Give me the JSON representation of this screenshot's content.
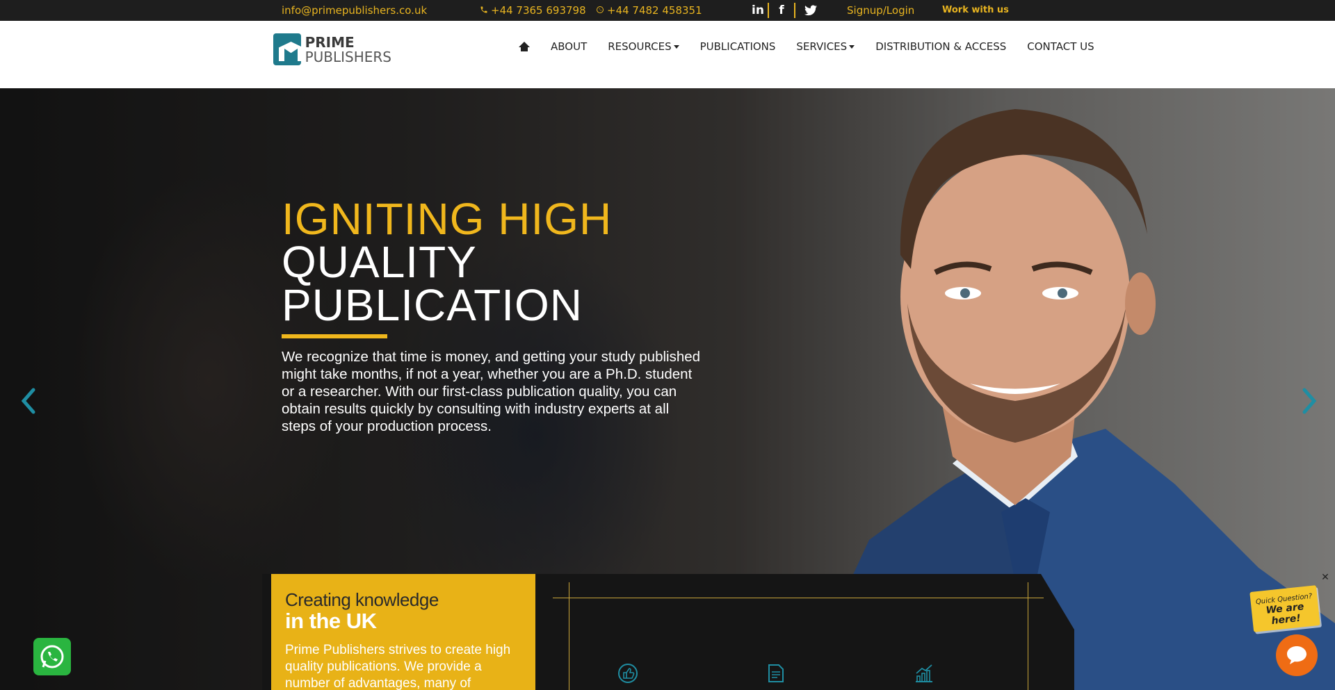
{
  "topbar": {
    "email": "info@primepublishers.co.uk",
    "phone": "+44 7365 693798",
    "whatsapp": "+44 7482 458351",
    "social": {
      "linkedin": "in",
      "facebook": "f"
    },
    "signup": "Signup/Login",
    "work": "Work with us"
  },
  "logo": {
    "line1": "PRIME",
    "line2": "PUBLISHERS"
  },
  "nav": {
    "about": "ABOUT",
    "resources": "RESOURCES",
    "publications": "PUBLICATIONS",
    "services": "SERVICES",
    "distribution": "DISTRIBUTION & ACCESS",
    "contact": "CONTACT US"
  },
  "hero": {
    "line1": "IGNITING HIGH",
    "line2": "QUALITY",
    "line3": "PUBLICATION",
    "lead": "We recognize that time is money, and getting your study published might take months, if not a year, whether you are a Ph.D. student or a researcher. With our first-class publication quality, you can obtain results quickly by consulting with industry experts at all steps of your production process."
  },
  "card": {
    "title1": "Creating knowledge",
    "title2": "in the UK",
    "body": "Prime Publishers strives to create high quality publications. We provide a number of advantages, many of"
  },
  "widgets": {
    "quick1": "Quick Question?",
    "quick2": "We are here!",
    "close": "✕"
  },
  "colors": {
    "accent": "#f0b71d",
    "teal": "#1f8ea3",
    "dark": "#1e1e1e"
  }
}
